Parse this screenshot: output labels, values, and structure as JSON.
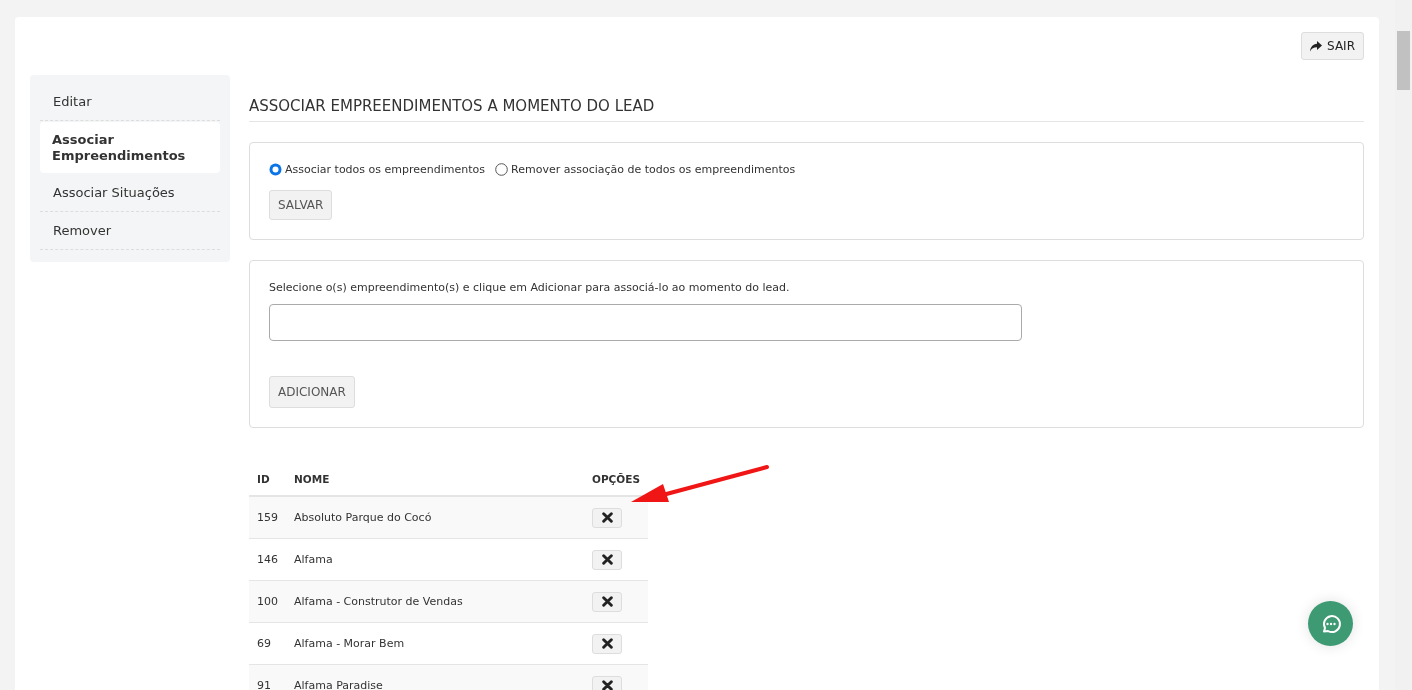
{
  "exit_button": {
    "label": "SAIR"
  },
  "sidebar": {
    "items": [
      {
        "label": "Editar",
        "selected": false
      },
      {
        "label": "Associar Empreendimentos",
        "selected": true
      },
      {
        "label": "Associar Situações",
        "selected": false
      },
      {
        "label": "Remover",
        "selected": false
      }
    ]
  },
  "title": "ASSOCIAR EMPREENDIMENTOS A MOMENTO DO LEAD",
  "association_panel": {
    "options": [
      {
        "label": "Associar todos os empreendimentos",
        "selected": true
      },
      {
        "label": "Remover associação de todos os empreendimentos",
        "selected": false
      }
    ],
    "button": "SALVAR"
  },
  "add_panel": {
    "instruction": "Selecione o(s) empreendimento(s) e clique em Adicionar para associá-lo ao momento do lead.",
    "button": "ADICIONAR"
  },
  "table": {
    "columns": [
      "ID",
      "NOME",
      "OPÇÕES"
    ],
    "rows": [
      {
        "id": "159",
        "name": "Absoluto Parque do Cocó"
      },
      {
        "id": "146",
        "name": "Alfama"
      },
      {
        "id": "100",
        "name": "Alfama - Construtor de Vendas"
      },
      {
        "id": "69",
        "name": "Alfama - Morar Bem"
      },
      {
        "id": "91",
        "name": "Alfama Paradise"
      }
    ]
  }
}
